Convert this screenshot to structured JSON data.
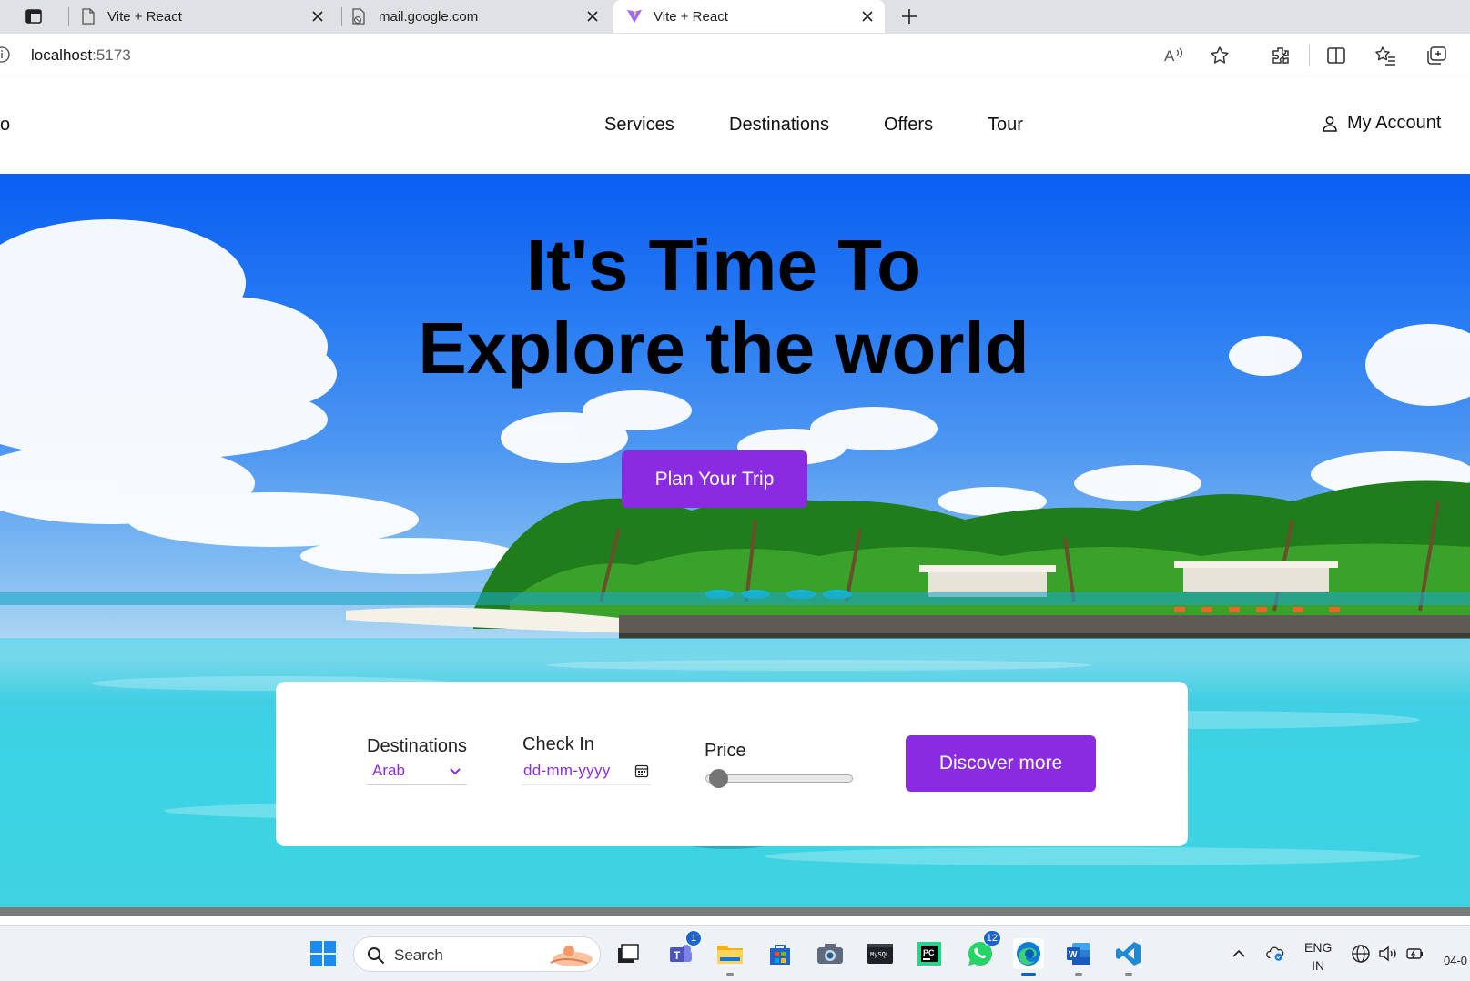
{
  "browser": {
    "tabs": [
      {
        "title": "Vite + React",
        "active": false
      },
      {
        "title": "mail.google.com",
        "active": false
      },
      {
        "title": "Vite + React",
        "active": true
      }
    ],
    "url_host": "localhost",
    "url_port": ":5173"
  },
  "nav": {
    "logo_fragment": "o",
    "links": [
      "Services",
      "Destinations",
      "Offers",
      "Tour"
    ],
    "account_label": "My Account"
  },
  "hero": {
    "title_line1": "It's Time To",
    "title_line2": "Explore the world",
    "cta_label": "Plan Your Trip"
  },
  "search_card": {
    "destinations_label": "Destinations",
    "destination_value": "Arab",
    "checkin_label": "Check In",
    "checkin_placeholder": "dd-mm-yyyy",
    "price_label": "Price",
    "price_slider_fraction": 0.0,
    "submit_label": "Discover more"
  },
  "taskbar": {
    "search_text": "Search",
    "teams_badge": "1",
    "whatsapp_badge": "12",
    "lang_line1": "ENG",
    "lang_line2": "IN",
    "clock_fragment": "04-0"
  },
  "colors": {
    "accent": "#8a2be2",
    "sky": "#0a5ef2",
    "sea": "#33d2e6"
  }
}
